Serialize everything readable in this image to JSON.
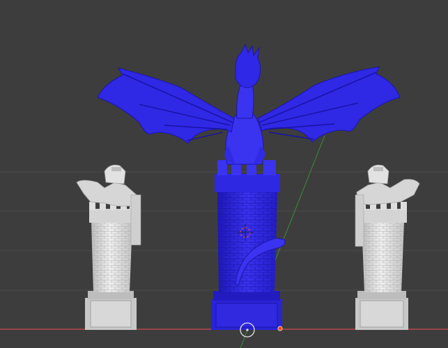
{
  "viewport": {
    "background": "#3d3d3d",
    "grid_color": "#4a4a4a",
    "x_axis_color": "#b44848",
    "y_axis_color": "#3f8a3f",
    "selection_color": "#2a23d8",
    "unselected_color": "#d9d9d9"
  },
  "scene": {
    "objects": [
      {
        "name": "dragon-tower",
        "selected": true
      },
      {
        "name": "knight-tower-left",
        "selected": false
      },
      {
        "name": "knight-tower-right",
        "selected": false
      }
    ],
    "cursor": {
      "label": "3d-cursor"
    },
    "origin": {
      "label": "object-origin"
    }
  }
}
